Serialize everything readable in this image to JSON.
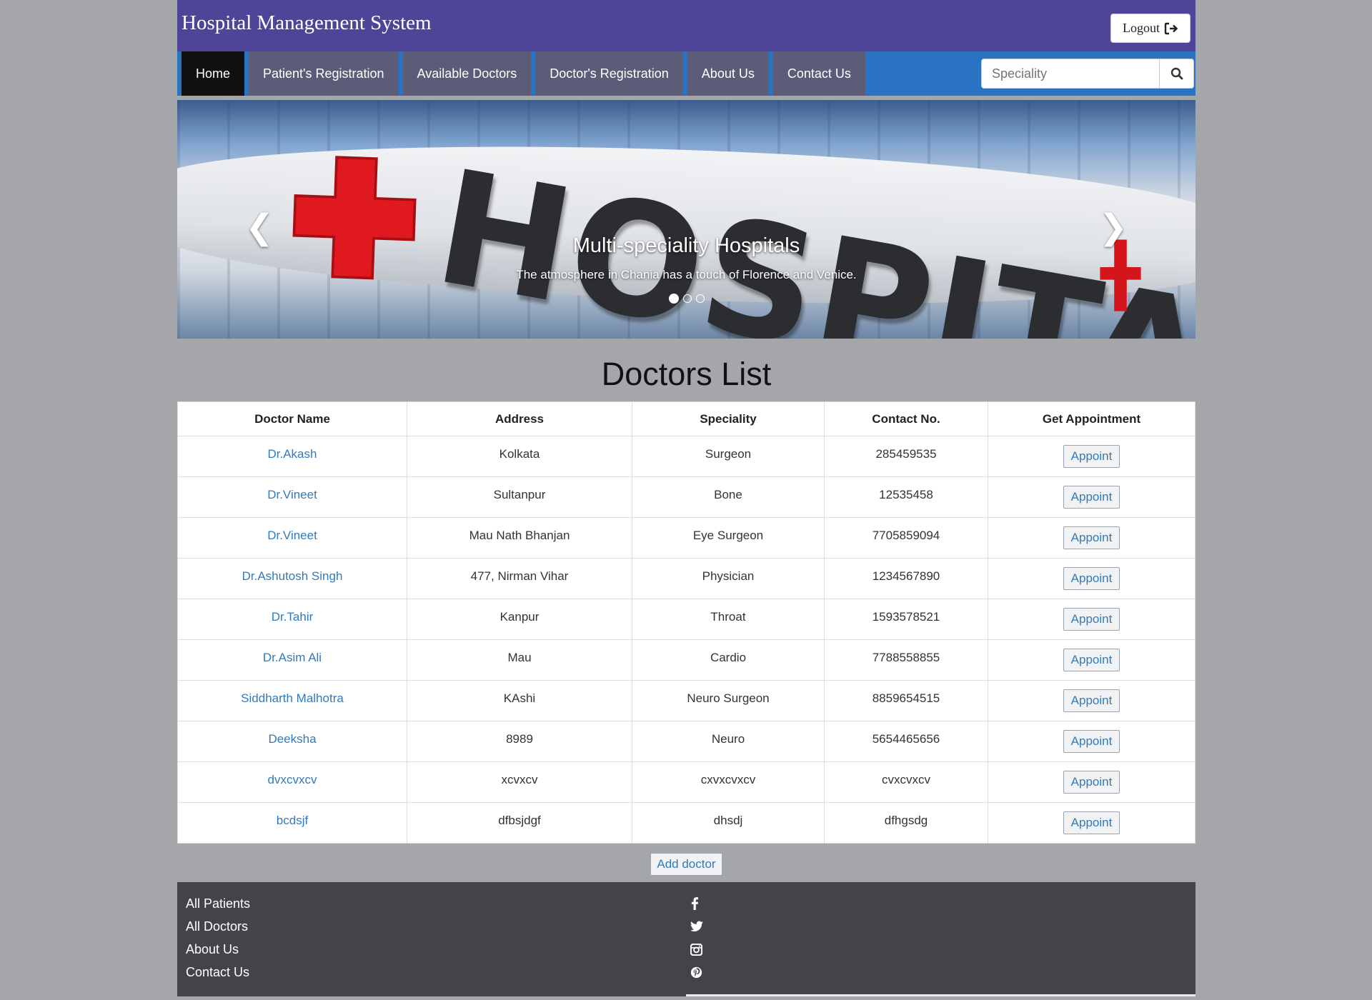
{
  "header": {
    "title": "Hospital Management System",
    "logout_label": "Logout"
  },
  "nav": {
    "items": [
      {
        "label": "Home",
        "active": true
      },
      {
        "label": "Patient's Registration"
      },
      {
        "label": "Available Doctors"
      },
      {
        "label": "Doctor's Registration"
      },
      {
        "label": "About Us"
      },
      {
        "label": "Contact Us"
      }
    ],
    "search_placeholder": "Speciality"
  },
  "carousel": {
    "sign_text": "HOSPITAL",
    "caption_title": "Multi-speciality Hospitals",
    "caption_text": "The atmosphere in Chania has a touch of Florence and Venice.",
    "slide_count": 3,
    "active_slide": 1
  },
  "doctors": {
    "title": "Doctors List",
    "columns": [
      "Doctor Name",
      "Address",
      "Speciality",
      "Contact No.",
      "Get Appointment"
    ],
    "appoint_label": "Appoint",
    "rows": [
      {
        "name": "Dr.Akash",
        "address": "Kolkata",
        "speciality": "Surgeon",
        "contact": "285459535"
      },
      {
        "name": "Dr.Vineet",
        "address": "Sultanpur",
        "speciality": "Bone",
        "contact": "12535458"
      },
      {
        "name": "Dr.Vineet",
        "address": "Mau Nath Bhanjan",
        "speciality": "Eye Surgeon",
        "contact": "7705859094"
      },
      {
        "name": "Dr.Ashutosh Singh",
        "address": "477, Nirman Vihar",
        "speciality": "Physician",
        "contact": "1234567890"
      },
      {
        "name": "Dr.Tahir",
        "address": "Kanpur",
        "speciality": "Throat",
        "contact": "1593578521"
      },
      {
        "name": "Dr.Asim Ali",
        "address": "Mau",
        "speciality": "Cardio",
        "contact": "7788558855"
      },
      {
        "name": "Siddharth Malhotra",
        "address": "KAshi",
        "speciality": "Neuro Surgeon",
        "contact": "8859654515"
      },
      {
        "name": "Deeksha",
        "address": "8989",
        "speciality": "Neuro",
        "contact": "5654465656"
      },
      {
        "name": "dvxcvxcv",
        "address": "xcvxcv",
        "speciality": "cxvxcvxcv",
        "contact": "cvxcvxcv"
      },
      {
        "name": "bcdsjf",
        "address": "dfbsjdgf",
        "speciality": "dhsdj",
        "contact": "dfhgsdg"
      }
    ],
    "add_label": "Add doctor"
  },
  "footer": {
    "links": [
      "All Patients",
      "All Doctors",
      "About Us",
      "Contact Us"
    ],
    "social_icons": [
      "facebook-icon",
      "twitter-icon",
      "instagram-icon",
      "pinterest-icon"
    ]
  },
  "colors": {
    "header_bg": "#4e4599",
    "navbar_bg": "#2a72c2",
    "nav_item_bg": "#5a5c78",
    "nav_active_bg": "#111111",
    "link": "#337ab7",
    "footer_bg": "#434349",
    "page_bg": "#a5a6aa"
  }
}
